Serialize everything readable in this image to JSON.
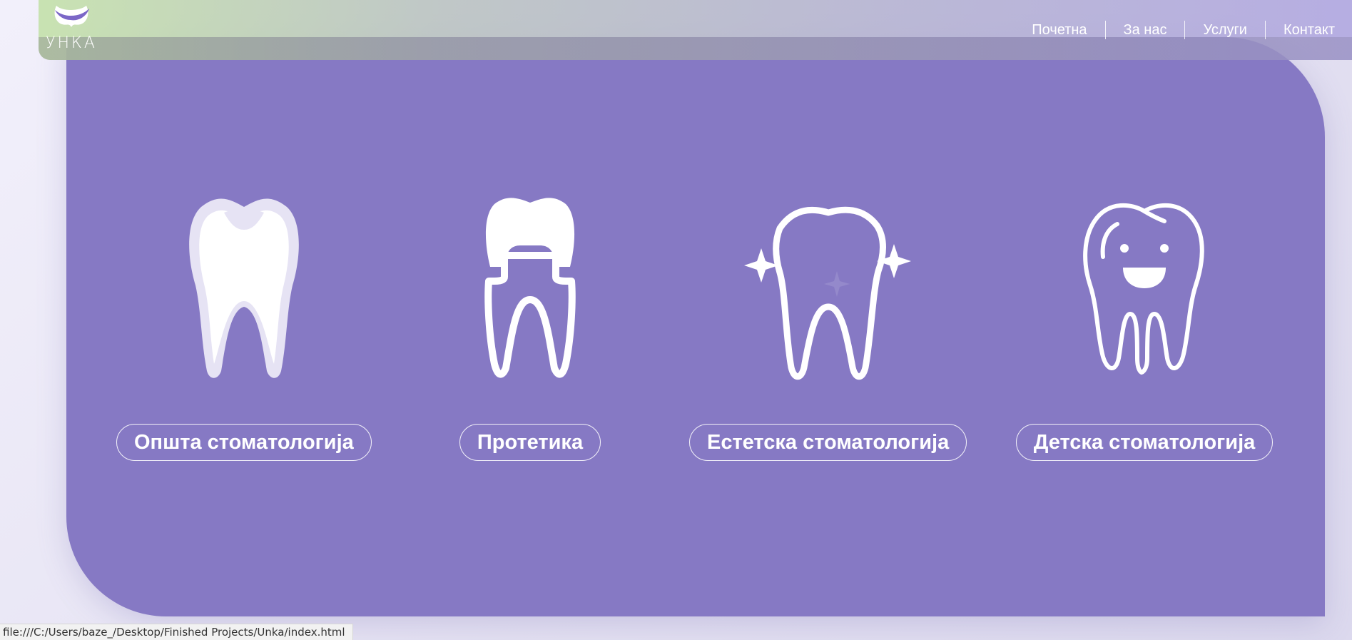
{
  "brand": {
    "name": "УНКА",
    "logo_icon": "tooth-logo-icon"
  },
  "nav": {
    "items": [
      "Почетна",
      "За нас",
      "Услуги",
      "Контакт"
    ]
  },
  "services": [
    {
      "label": "Општа стоматологија",
      "icon": "tooth-icon"
    },
    {
      "label": "Протетика",
      "icon": "crown-tooth-icon"
    },
    {
      "label": "Естетска стоматологија",
      "icon": "sparkling-tooth-icon"
    },
    {
      "label": "Детска стоматологија",
      "icon": "smiling-tooth-icon"
    }
  ],
  "status_bar": {
    "url": "file:///C:/Users/baze_/Desktop/Finished Projects/Unka/index.html"
  },
  "colors": {
    "panel": "#8679c4",
    "text": "#ffffff"
  }
}
